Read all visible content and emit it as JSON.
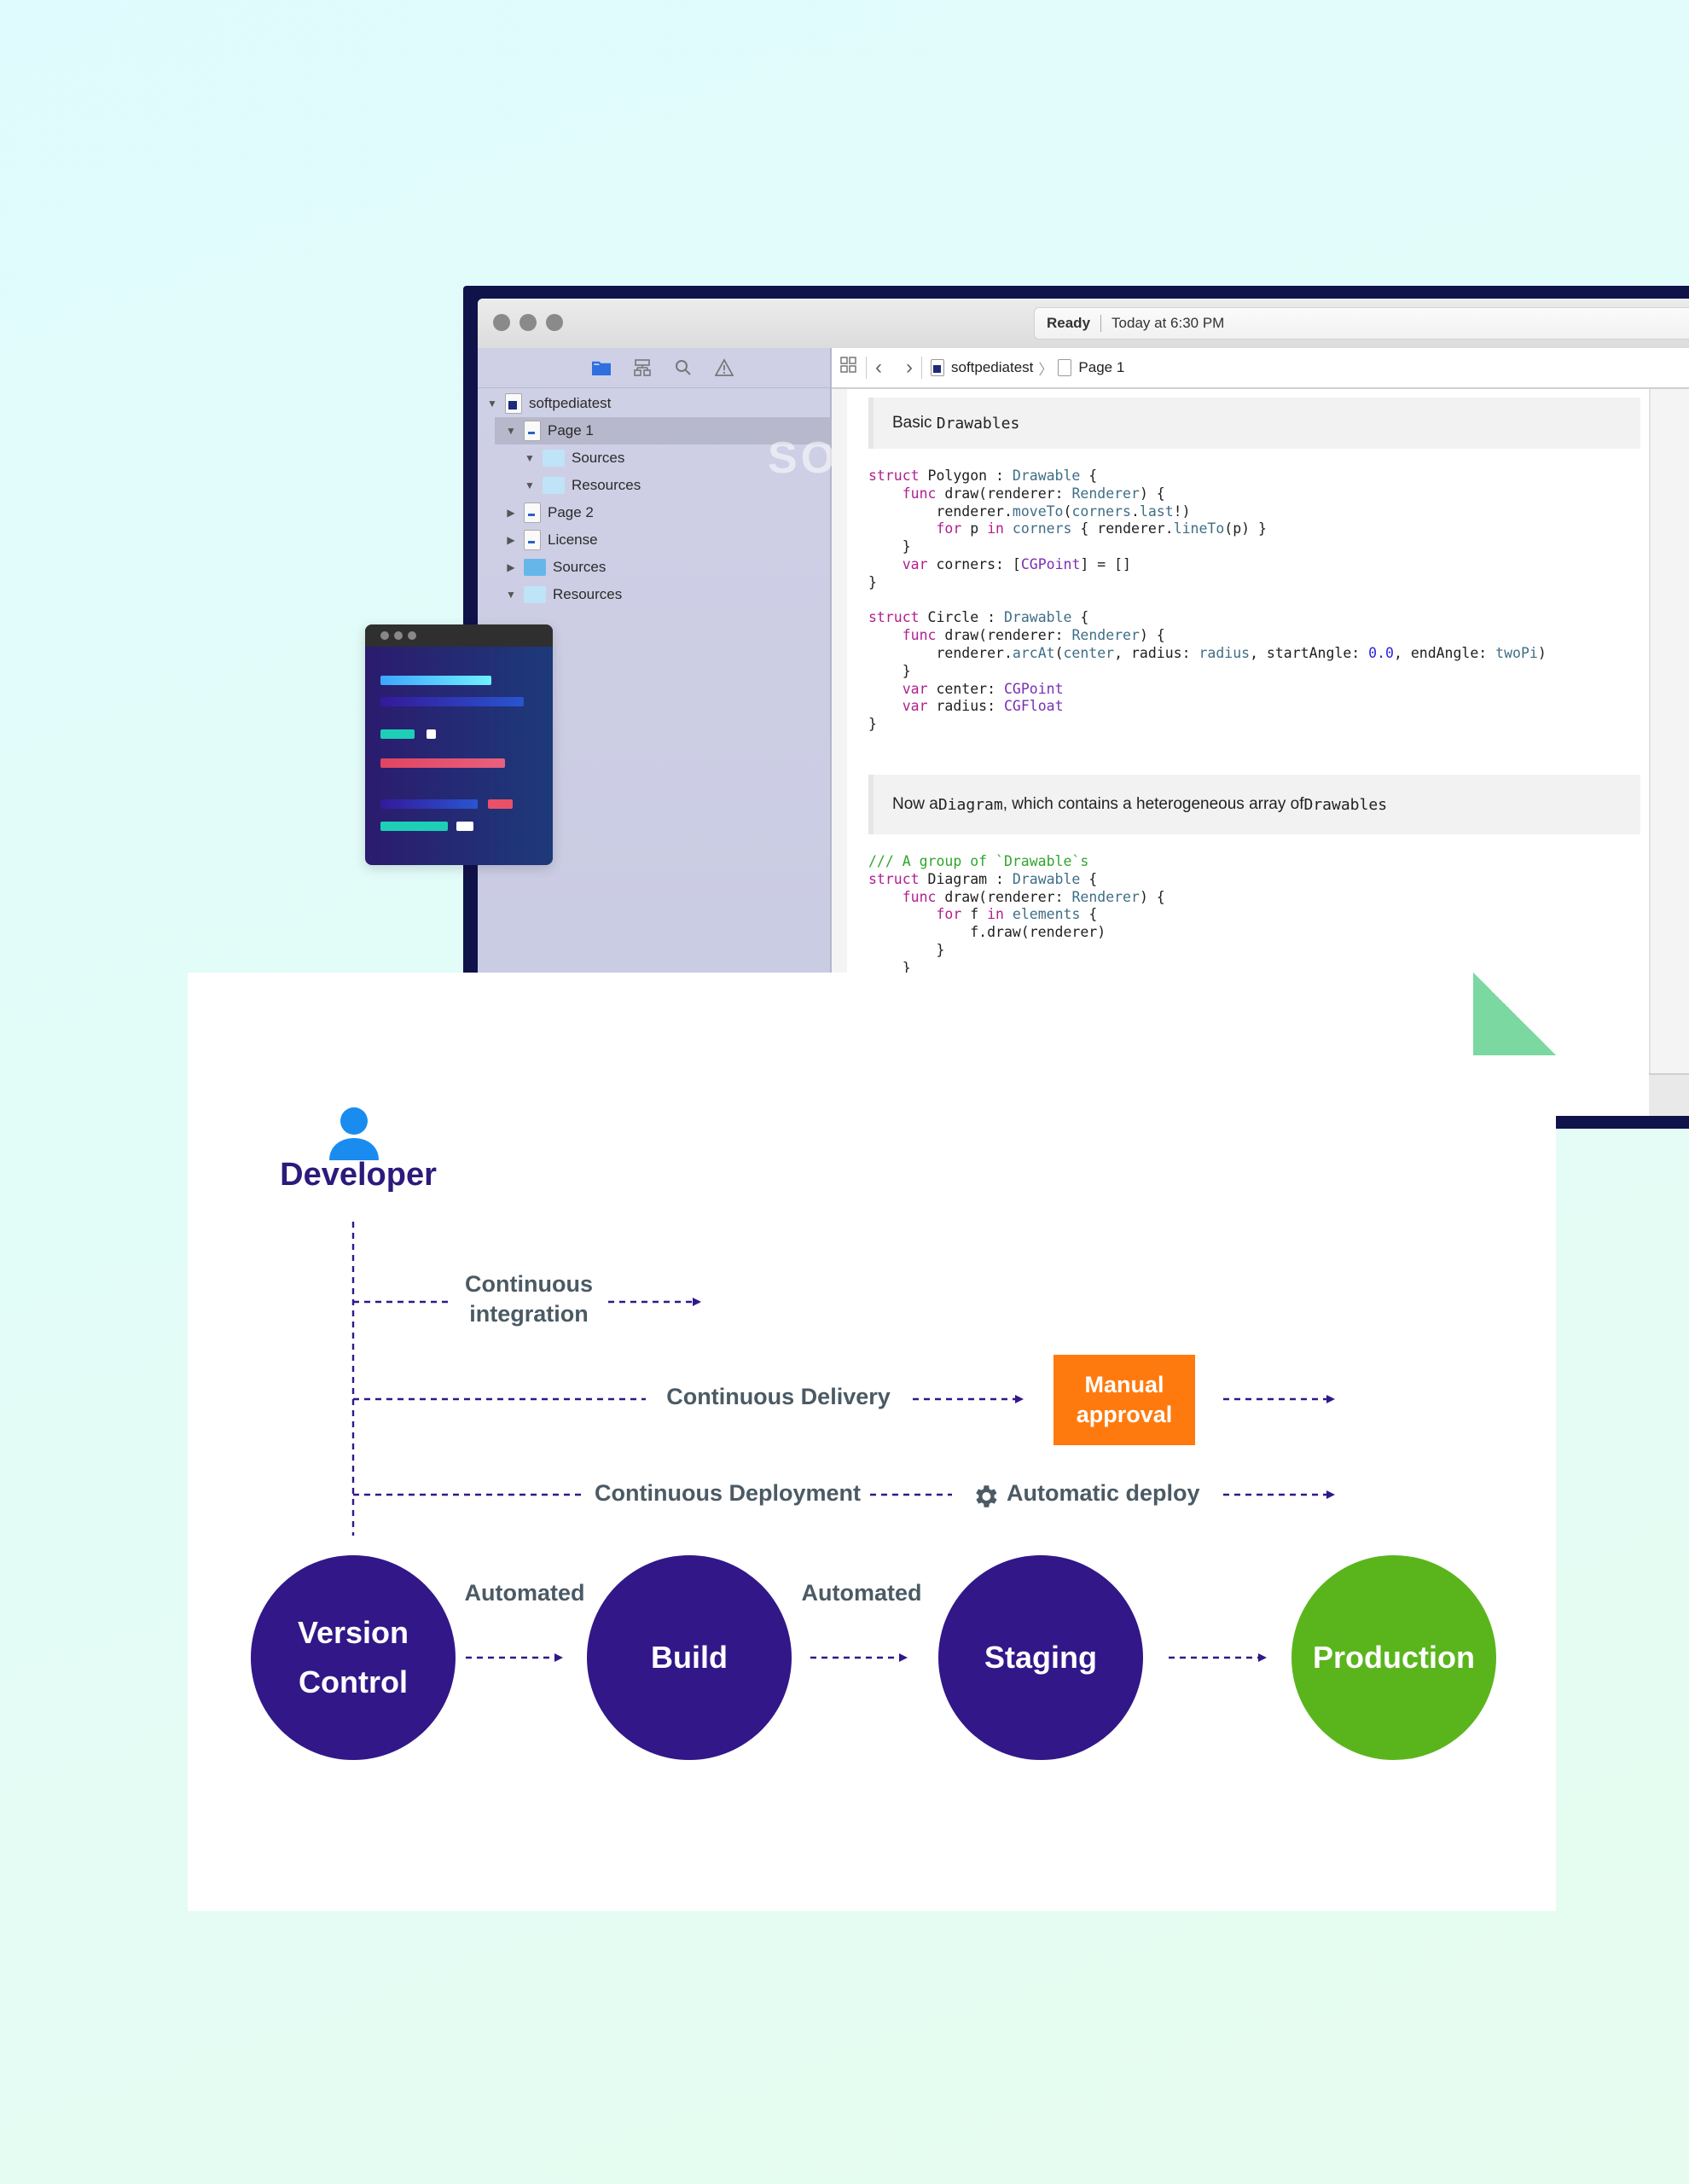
{
  "xcode": {
    "status": {
      "state": "Ready",
      "time": "Today at 6:30 PM"
    },
    "sidebar_icons": [
      "folder-icon",
      "hierarchy-icon",
      "search-icon",
      "warning-icon"
    ],
    "tree": [
      {
        "label": "softpediatest",
        "disclosure": "▼",
        "icon": "project"
      },
      {
        "label": "Page 1",
        "disclosure": "▼",
        "icon": "swift-page",
        "selected": true
      },
      {
        "label": "Sources",
        "disclosure": "▼",
        "icon": "folder"
      },
      {
        "label": "Resources",
        "disclosure": "▼",
        "icon": "folder"
      },
      {
        "label": "Page 2",
        "disclosure": "▶",
        "icon": "swift-page"
      },
      {
        "label": "License",
        "disclosure": "▶",
        "icon": "swift-page"
      },
      {
        "label": "Sources",
        "disclosure": "▶",
        "icon": "folder-strong"
      },
      {
        "label": "Resources",
        "disclosure": "▼",
        "icon": "folder"
      }
    ],
    "watermark": "SOFTPEDIA",
    "breadcrumb": [
      "softpediatest",
      "Page 1"
    ],
    "doc1": {
      "prefix": "Basic ",
      "mono": "Drawables"
    },
    "doc2": {
      "t1": "Now a ",
      "m1": "Diagram",
      "t2": ", which contains a heterogeneous array of ",
      "m2": "Drawables"
    }
  },
  "diagram": {
    "developer_label": "Developer",
    "flows": {
      "ci": "Continuous integration",
      "cdelivery": "Continuous Delivery",
      "cdeploy": "Continuous Deployment",
      "manual_approval": "Manual approval",
      "automatic_deploy": "Automatic deploy"
    },
    "edges": {
      "automated_1": "Automated",
      "automated_2": "Automated"
    },
    "stages": [
      {
        "label": "Version Control",
        "color": "#321789"
      },
      {
        "label": "Build",
        "color": "#321789"
      },
      {
        "label": "Staging",
        "color": "#321789"
      },
      {
        "label": "Production",
        "color": "#5ab51d"
      }
    ],
    "colors": {
      "accent": "#321789",
      "production": "#5ab51d",
      "manual": "#ff7a0e",
      "developer_icon": "#1a8cf0",
      "label": "#4b5a64"
    }
  }
}
